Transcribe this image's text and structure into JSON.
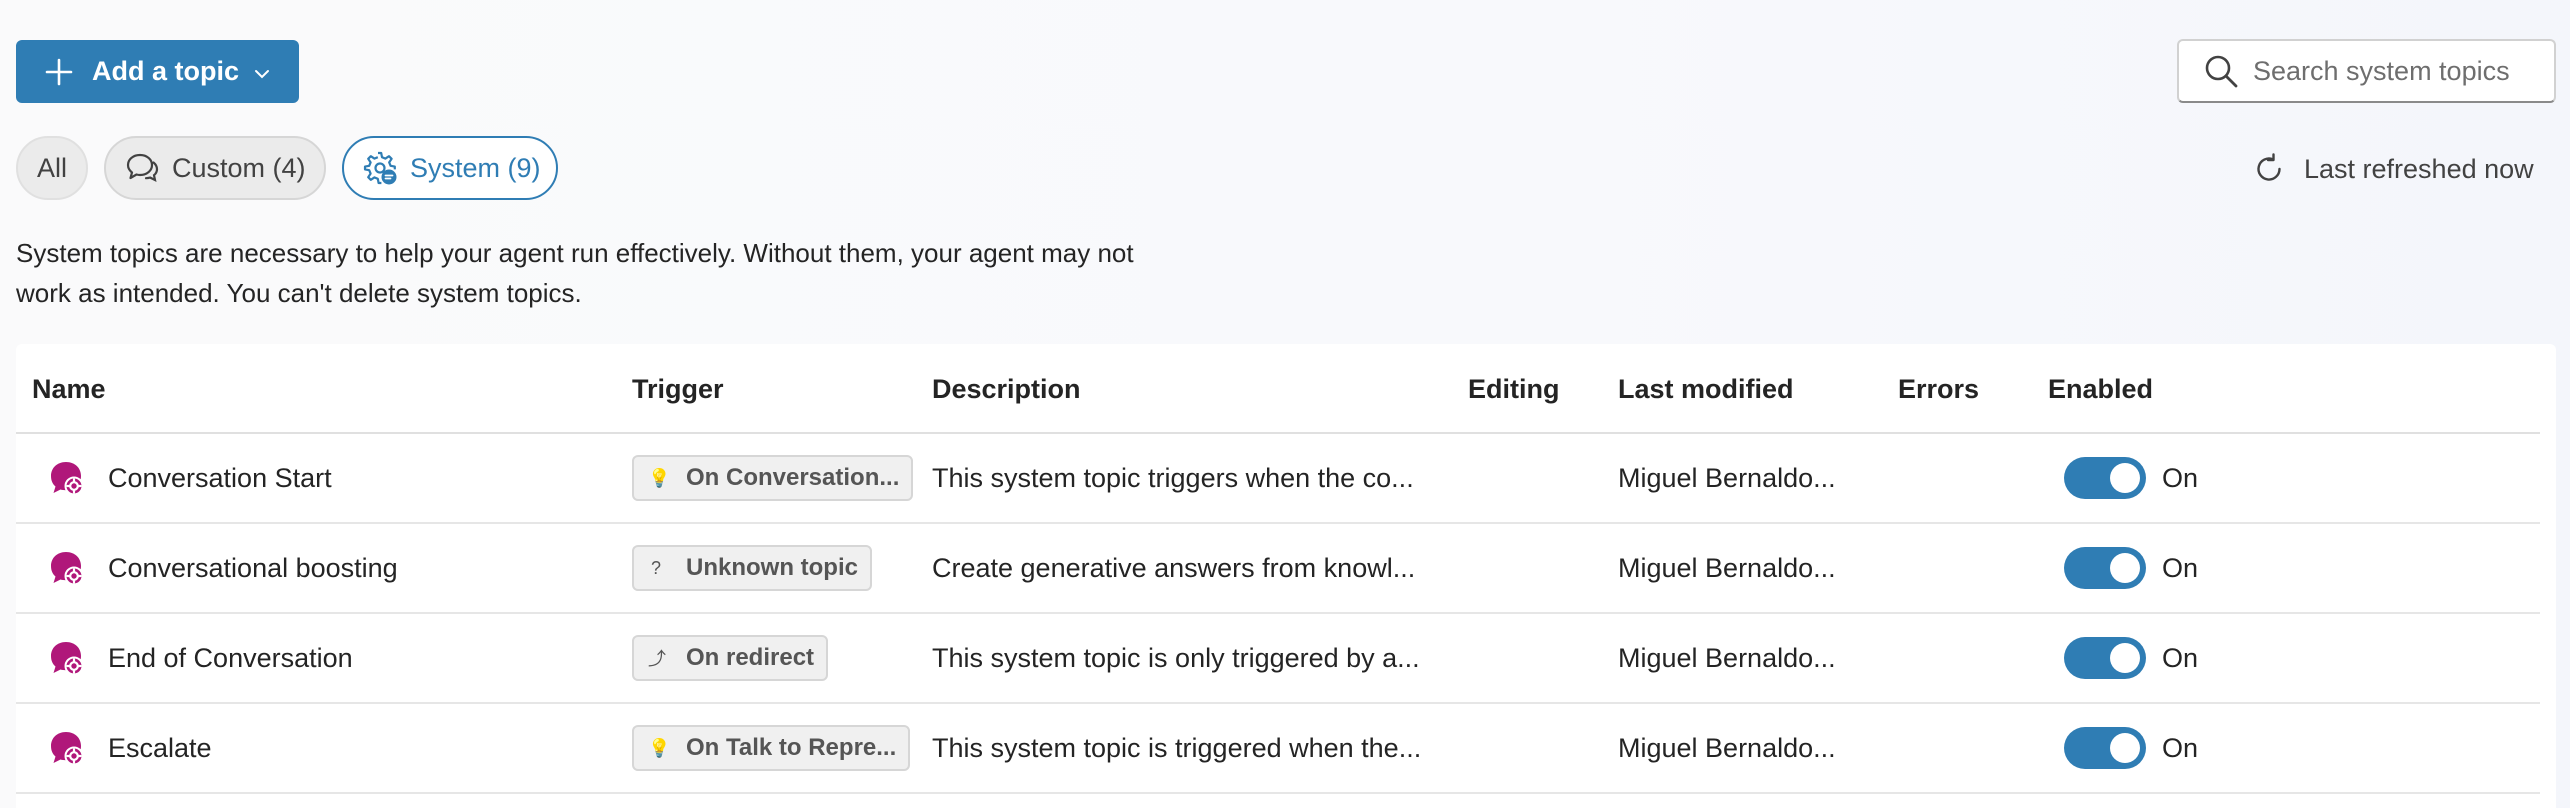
{
  "toolbar": {
    "add_label": "Add a topic",
    "search_placeholder": "Search system topics"
  },
  "filters": {
    "all": "All",
    "custom": "Custom (4)",
    "system": "System (9)",
    "selected": "System (9)"
  },
  "refresh_label": "Last refreshed now",
  "description": "System topics are necessary to help your agent run effectively. Without them, your agent may not work as intended. You can't delete system topics.",
  "table": {
    "columns": {
      "name": "Name",
      "trigger": "Trigger",
      "description": "Description",
      "editing": "Editing",
      "last_modified": "Last modified",
      "errors": "Errors",
      "enabled": "Enabled"
    },
    "rows": [
      {
        "name": "Conversation Start",
        "trigger_icon": "lightbulb-icon",
        "trigger": "On Conversation...",
        "description": "This system topic triggers when the co...",
        "last_modified": "Miguel Bernaldo...",
        "enabled": "On"
      },
      {
        "name": "Conversational boosting",
        "trigger_icon": "question-icon",
        "trigger": "Unknown topic",
        "description": "Create generative answers from knowl...",
        "last_modified": "Miguel Bernaldo...",
        "enabled": "On"
      },
      {
        "name": "End of Conversation",
        "trigger_icon": "redirect-icon",
        "trigger": "On redirect",
        "description": "This system topic is only triggered by a...",
        "last_modified": "Miguel Bernaldo...",
        "enabled": "On"
      },
      {
        "name": "Escalate",
        "trigger_icon": "lightbulb-icon",
        "trigger": "On Talk to Repre...",
        "description": "This system topic is triggered when the...",
        "last_modified": "Miguel Bernaldo...",
        "enabled": "On"
      }
    ]
  },
  "colors": {
    "accent": "#2f7db4",
    "topic_icon": "#b0177a"
  }
}
